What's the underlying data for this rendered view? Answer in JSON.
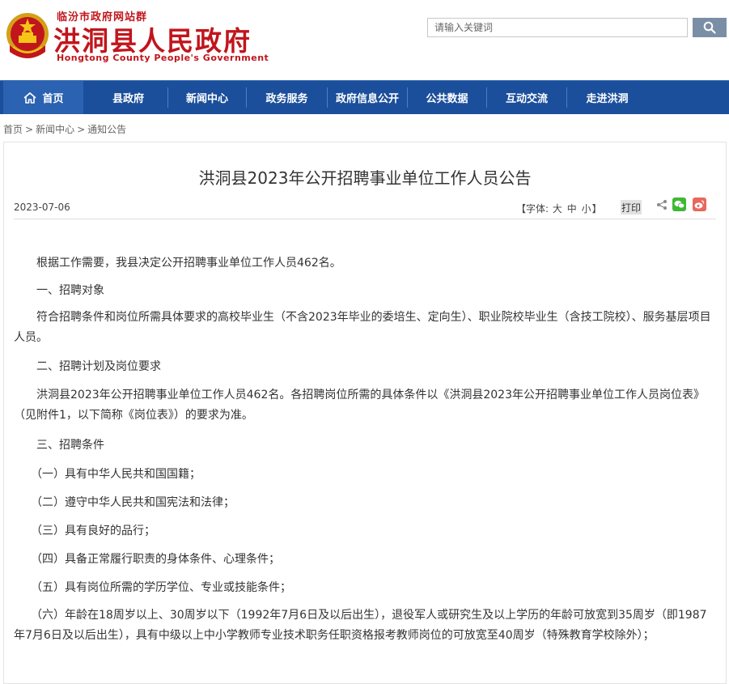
{
  "header": {
    "site_group": "临汾市政府网站群",
    "site_title": "洪洞县人民政府",
    "site_subtitle": "Hongtong County People's Government",
    "emblem_icon": "national-emblem-icon"
  },
  "search": {
    "placeholder": "请输入关键词",
    "icon": "search-icon"
  },
  "nav": {
    "items": [
      "首页",
      "县政府",
      "新闻中心",
      "政务服务",
      "政府信息公开",
      "公共数据",
      "互动交流",
      "走进洪洞"
    ],
    "home_icon": "home-icon"
  },
  "breadcrumb": {
    "items": [
      "首页",
      "新闻中心",
      "通知公告"
    ],
    "separator": ">"
  },
  "article": {
    "title": "洪洞县2023年公开招聘事业单位工作人员公告",
    "date": "2023-07-06",
    "font_size": {
      "label_open": "【字体:",
      "large": "大",
      "medium": "中",
      "small": "小",
      "label_close": "】"
    },
    "print_label": "打印",
    "share_icons": [
      "share-icon",
      "wechat-icon",
      "weibo-icon"
    ],
    "paragraphs": [
      "　　根据工作需要，我县决定公开招聘事业单位工作人员462名。",
      "　　一、招聘对象",
      "　　符合招聘条件和岗位所需具体要求的高校毕业生（不含2023年毕业的委培生、定向生）、职业院校毕业生（含技工院校）、服务基层项目人员。",
      "　　二、招聘计划及岗位要求",
      "　　洪洞县2023年公开招聘事业单位工作人员462名。各招聘岗位所需的具体条件以《洪洞县2023年公开招聘事业单位工作人员岗位表》（见附件1，以下简称《岗位表》）的要求为准。",
      "　　三、招聘条件",
      "　　（一）具有中华人民共和国国籍；",
      "　　（二）遵守中华人民共和国宪法和法律；",
      "　　（三）具有良好的品行；",
      "　　（四）具备正常履行职责的身体条件、心理条件；",
      "　　（五）具有岗位所需的学历学位、专业或技能条件；",
      "　　（六）年龄在18周岁以上、30周岁以下（1992年7月6日及以后出生），退役军人或研究生及以上学历的年龄可放宽到35周岁（即1987年7月6日及以后出生），具有中级以上中小学教师专业技术职务任职资格报考教师岗位的可放宽至40周岁（特殊教育学校除外）；"
    ]
  },
  "colors": {
    "brand_red": "#c0161c",
    "nav_blue": "#1b4f9b",
    "nav_home_blue": "#2b62b1",
    "search_button": "#7a8fa6"
  }
}
